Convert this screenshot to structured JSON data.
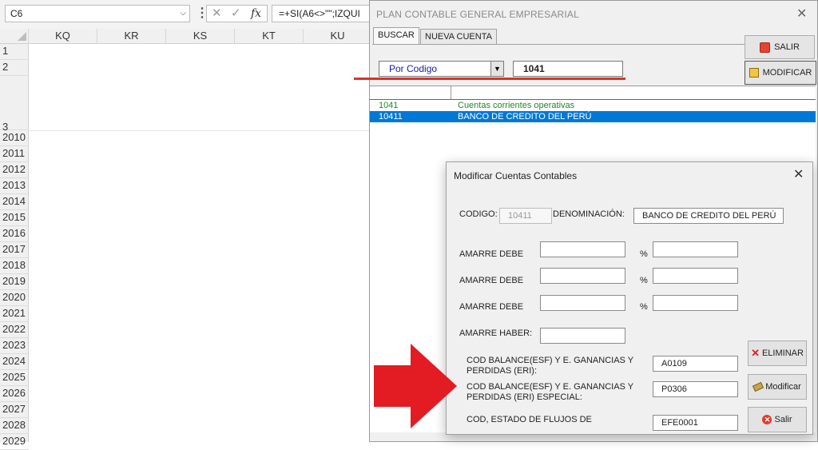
{
  "excel": {
    "name_box": "C6",
    "formula_text": "=+SI(A6<>\"\";IZQUI",
    "columns": [
      "KQ",
      "KR",
      "KS",
      "KT",
      "KU"
    ],
    "rows": [
      "1",
      "2",
      "3",
      "2010",
      "2011",
      "2012",
      "2013",
      "2014",
      "2015",
      "2016",
      "2017",
      "2018",
      "2019",
      "2020",
      "2021",
      "2022",
      "2023",
      "2024",
      "2025",
      "2026",
      "2027",
      "2028",
      "2029"
    ]
  },
  "main_window": {
    "title": "PLAN CONTABLE GENERAL EMPRESARIAL",
    "close": "✕",
    "tabs": [
      "BUSCAR",
      "NUEVA CUENTA"
    ],
    "btn_salir": "SALIR",
    "btn_modificar": "MODIFICAR",
    "search_mode": "Por Codigo",
    "search_value": "1041",
    "results": [
      {
        "code": "1041",
        "name": "Cuentas corrientes operativas"
      },
      {
        "code": "10411",
        "name": "BANCO DE CREDITO DEL PERÚ"
      }
    ]
  },
  "dialog": {
    "title": "Modificar Cuentas Contables",
    "close": "✕",
    "codigo_label": "CODIGO:",
    "codigo_value": "10411",
    "denominacion_label": "DENOMINACIÓN:",
    "denominacion_value": "BANCO DE CREDITO DEL PERÚ",
    "amarre_debe_label": "AMARRE DEBE",
    "percent": "%",
    "amarre_haber_label": "AMARRE HABER:",
    "cod_balance_label": "COD BALANCE(ESF) Y E. GANANCIAS Y PERDIDAS (ERI):",
    "cod_balance_value": "A0109",
    "cod_balance_esp_label": "COD BALANCE(ESF) Y E. GANANCIAS Y PERDIDAS (ERI) ESPECIAL:",
    "cod_balance_esp_value": "P0306",
    "cod_flujos_label": "COD, ESTADO DE FLUJOS DE",
    "cod_flujos_value": "EFE0001",
    "btn_eliminar": "ELIMINAR",
    "btn_modificar": "Modificar",
    "btn_salir": "Salir"
  },
  "colors": {
    "selection": "#0078d7",
    "green_text": "#1f8a23",
    "annotation_red": "#e31b23"
  }
}
